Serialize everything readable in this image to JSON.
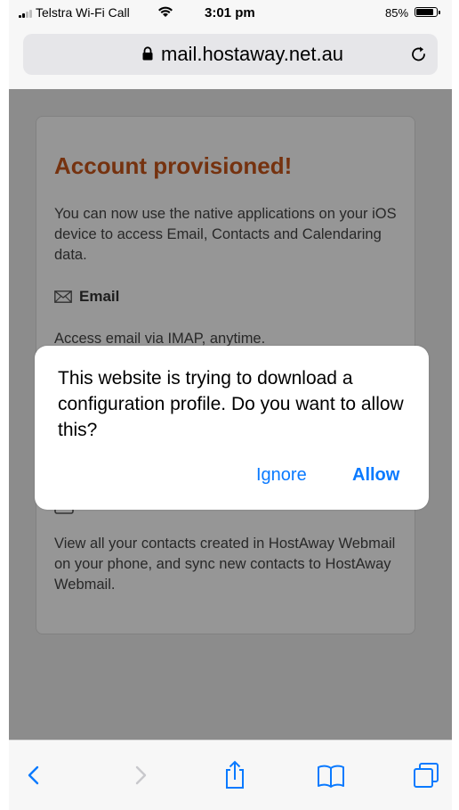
{
  "status_bar": {
    "carrier": "Telstra Wi-Fi Call",
    "time": "3:01 pm",
    "battery_percent": "85%",
    "battery_level": 0.85,
    "icons": [
      "signal-icon",
      "wifi-icon",
      "battery-icon"
    ]
  },
  "address_bar": {
    "url": "mail.hostaway.net.au",
    "icons": [
      "lock-icon",
      "reload-icon"
    ]
  },
  "page": {
    "title": "Account provisioned!",
    "intro": "You can now use the native applications on your iOS device to access Email, Contacts and Calendaring data.",
    "email_section": {
      "icon": "envelope-icon",
      "title": "Email",
      "description": "Access email via IMAP, anytime."
    },
    "contacts_section": {
      "icon": "contacts-icon",
      "description": "View all your contacts created in HostAway Webmail on your phone, and sync new contacts to HostAway Webmail."
    }
  },
  "alert": {
    "message": "This website is trying to download a configuration profile. Do you want to allow this?",
    "ignore_label": "Ignore",
    "allow_label": "Allow",
    "button_color": "#0a7aff"
  },
  "toolbar": {
    "icons": [
      "back-icon",
      "forward-icon",
      "share-icon",
      "bookmarks-icon",
      "tabs-icon"
    ]
  },
  "colors": {
    "title_accent": "#c4541a",
    "link_blue": "#0a7aff"
  }
}
